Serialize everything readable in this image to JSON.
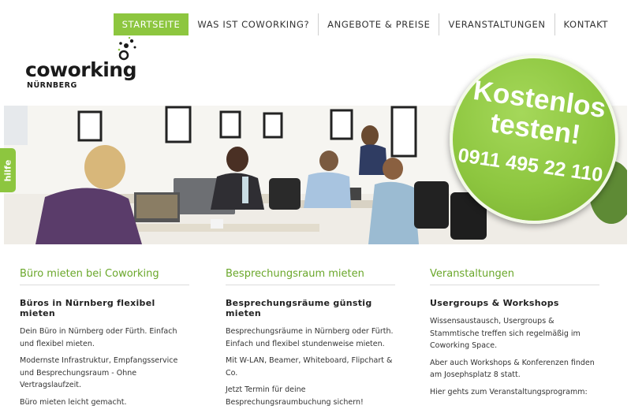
{
  "nav": {
    "items": [
      "STARTSEITE",
      "WAS IST COWORKING?",
      "ANGEBOTE & PREISE",
      "VERANSTALTUNGEN",
      "KONTAKT"
    ],
    "active": "STARTSEITE"
  },
  "logo": {
    "word": "coworking",
    "sub": "NÜRNBERG"
  },
  "side_tab": {
    "label": "hilfe"
  },
  "badge": {
    "line1": "Kostenlos",
    "line2": "testen!",
    "phone": "0911 495 22 110"
  },
  "columns": [
    {
      "title": "Büro mieten bei Coworking",
      "subtitle": "Büros in Nürnberg flexibel mieten",
      "paragraphs": [
        "Dein Büro in Nürnberg oder Fürth. Einfach und flexibel mieten.",
        "Modernste Infrastruktur, Empfangsservice und Besprechungsraum - Ohne Vertragslaufzeit.",
        "Büro mieten leicht gemacht."
      ]
    },
    {
      "title": "Besprechungsraum mieten",
      "subtitle": "Besprechungsräume günstig mieten",
      "paragraphs": [
        "Besprechungsräume in Nürnberg oder Fürth. Einfach und flexibel stundenweise mieten.",
        "Mit W-LAN, Beamer, Whiteboard, Flipchart & Co.",
        "Jetzt Termin für deine Besprechungsraumbuchung sichern!"
      ]
    },
    {
      "title": "Veranstaltungen",
      "subtitle": "Usergroups & Workshops",
      "paragraphs": [
        "Wissensaustausch, Usergroups & Stammtische treffen sich regelmäßig im Coworking Space.",
        "Aber auch Workshops & Konferenzen finden am Josephsplatz 8 statt.",
        "Hier gehts zum Veranstaltungsprogramm:"
      ]
    }
  ],
  "colors": {
    "accent": "#8dc63f",
    "title_green": "#6aa72a",
    "text": "#333333"
  }
}
